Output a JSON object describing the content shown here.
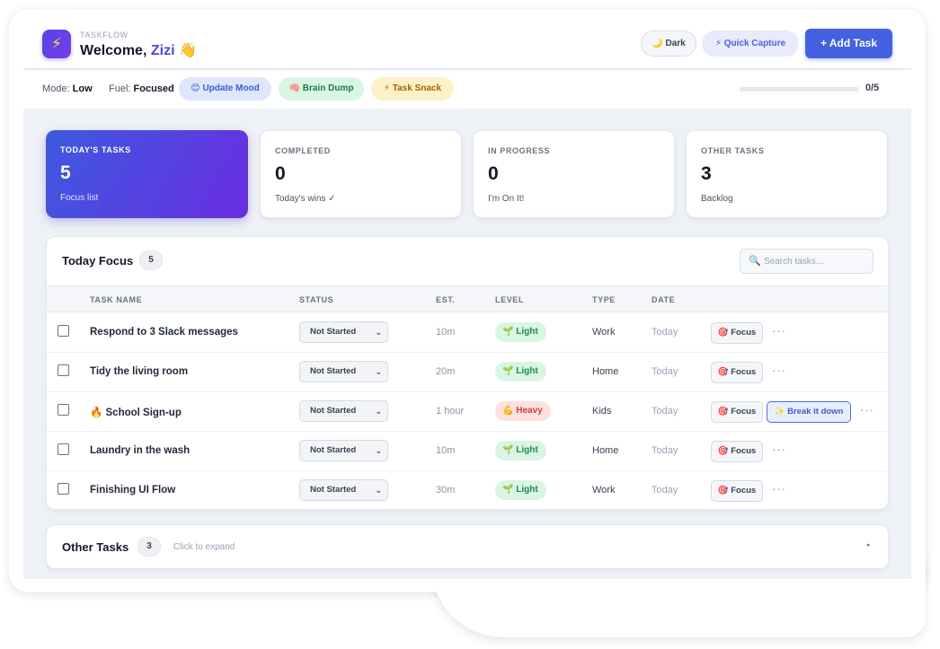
{
  "header": {
    "logo_glyph": "⚡",
    "brand": "TASKFLOW",
    "welcome_prefix": "Welcome,",
    "user_name": "Zizi",
    "wave": "👋",
    "dark_label": "🌙 Dark",
    "quick_capture_label": "⚡ Quick Capture",
    "add_task_label": "+ Add Task"
  },
  "subbar": {
    "mode_label": "Mode:",
    "mode_value": "Low",
    "fuel_label": "Fuel:",
    "fuel_value": "Focused",
    "update_mood_label": "😊 Update Mood",
    "brain_dump_label": "🧠 Brain Dump",
    "task_snack_label": "⚡ Task Snack",
    "progress_fraction": 0,
    "progress_label": "0/5"
  },
  "cards": [
    {
      "label": "TODAY'S TASKS",
      "value": "5",
      "sub": "Focus list"
    },
    {
      "label": "COMPLETED",
      "value": "0",
      "sub": "Today's wins ✓"
    },
    {
      "label": "IN PROGRESS",
      "value": "0",
      "sub": "I'm On It!"
    },
    {
      "label": "OTHER TASKS",
      "value": "3",
      "sub": "Backlog"
    }
  ],
  "today_focus": {
    "title": "Today Focus",
    "count": "5",
    "search_placeholder": "Search tasks...",
    "columns": [
      "TASK NAME",
      "STATUS",
      "EST.",
      "LEVEL",
      "TYPE",
      "DATE"
    ],
    "rows": [
      {
        "name": "Respond to 3 Slack messages",
        "status": "Not Started",
        "est": "10m",
        "level": "🌱 Light",
        "level_kind": "light",
        "type": "Work",
        "date": "Today",
        "focus": "🎯 Focus",
        "break": ""
      },
      {
        "name": "Tidy the living room",
        "status": "Not Started",
        "est": "20m",
        "level": "🌱 Light",
        "level_kind": "light",
        "type": "Home",
        "date": "Today",
        "focus": "🎯 Focus",
        "break": ""
      },
      {
        "name": "🔥 School Sign-up",
        "status": "Not Started",
        "est": "1 hour",
        "level": "💪 Heavy",
        "level_kind": "heavy",
        "type": "Kids",
        "date": "Today",
        "focus": "🎯 Focus",
        "break": "✨ Break it down"
      },
      {
        "name": "Laundry in the wash",
        "status": "Not Started",
        "est": "10m",
        "level": "🌱 Light",
        "level_kind": "light",
        "type": "Home",
        "date": "Today",
        "focus": "🎯 Focus",
        "break": ""
      },
      {
        "name": "Finishing UI Flow",
        "status": "Not Started",
        "est": "30m",
        "level": "🌱 Light",
        "level_kind": "light",
        "type": "Work",
        "date": "Today",
        "focus": "🎯 Focus",
        "break": ""
      }
    ],
    "more_glyph": "···",
    "chevron_glyph": "⌄"
  },
  "other_tasks": {
    "title": "Other Tasks",
    "count": "3",
    "hint": "Click to expand",
    "caret": "▸"
  },
  "colors": {
    "accent": "#4361e0",
    "brand_gradient_start": "#3d5ae0",
    "brand_gradient_end": "#6a2de0",
    "light_level": "#1f8a4c",
    "heavy_level": "#d33b3b"
  }
}
